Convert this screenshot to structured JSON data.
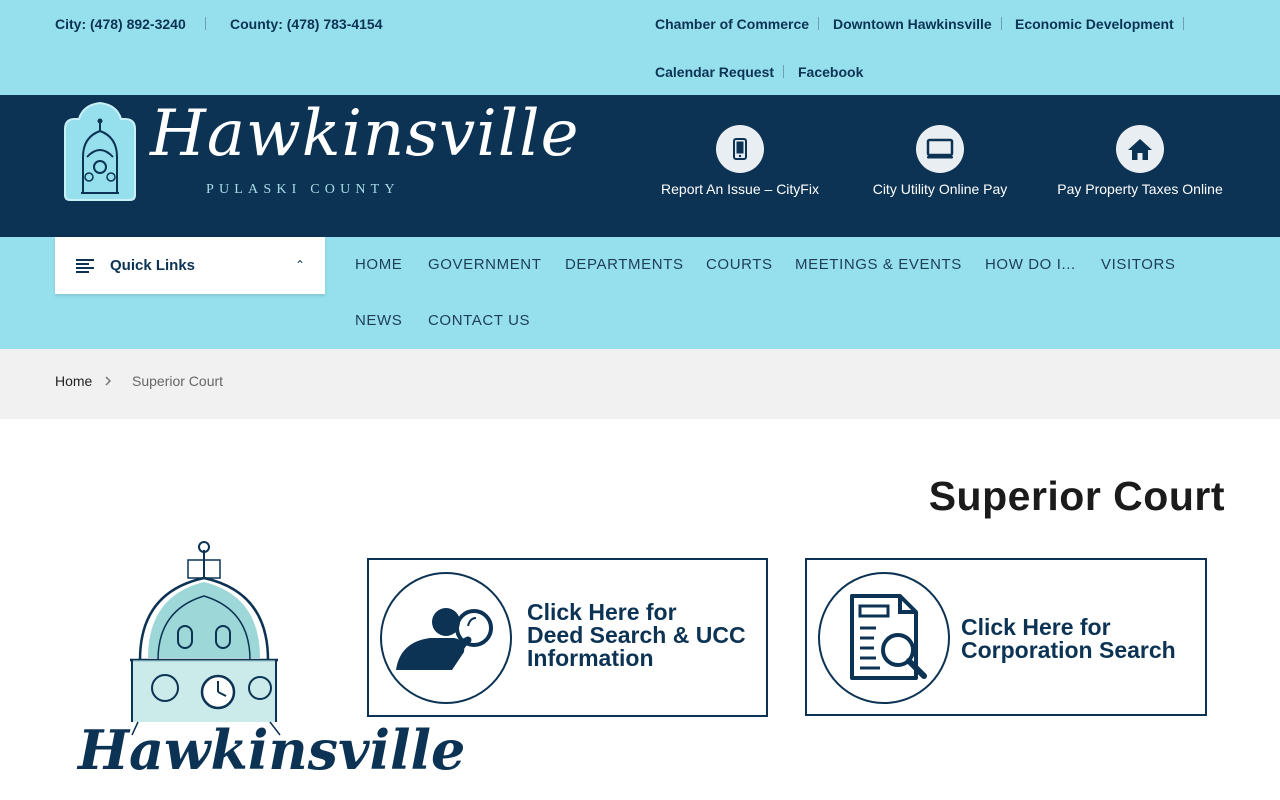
{
  "topbar": {
    "city_phone": "City: (478) 892-3240",
    "county_phone": "County: (478) 783-4154",
    "links": [
      "Chamber of Commerce",
      "Downtown Hawkinsville",
      "Economic Development",
      "Calendar Request",
      "Facebook"
    ]
  },
  "header": {
    "logo_wordmark": "Hawkinsville",
    "logo_subtitle": "PULASKI COUNTY",
    "quick_actions": [
      {
        "label": "Report An Issue – CityFix",
        "icon": "mobile-phone-icon"
      },
      {
        "label": "City Utility Online Pay",
        "icon": "monitor-icon"
      },
      {
        "label": "Pay Property Taxes Online",
        "icon": "home-icon"
      }
    ]
  },
  "nav": {
    "quick_links_label": "Quick Links",
    "items": [
      "HOME",
      "GOVERNMENT",
      "DEPARTMENTS",
      "COURTS",
      "MEETINGS & EVENTS",
      "HOW DO I...",
      "VISITORS",
      "NEWS",
      "CONTACT US"
    ]
  },
  "breadcrumb": {
    "home": "Home",
    "current": "Superior Court"
  },
  "content": {
    "title": "Superior Court",
    "logo_wordmark": "Hawkinsville",
    "cards": [
      {
        "line1": "Click Here for",
        "line2": "Deed Search & UCC",
        "line3": "Information",
        "icon": "deed-search-person-icon"
      },
      {
        "line1": "Click Here for",
        "line2": "Corporation Search",
        "icon": "document-search-icon"
      }
    ]
  },
  "colors": {
    "light_blue": "#95e0ec",
    "navy": "#0c3354",
    "breadcrumb_bg": "#f1f1f1"
  }
}
